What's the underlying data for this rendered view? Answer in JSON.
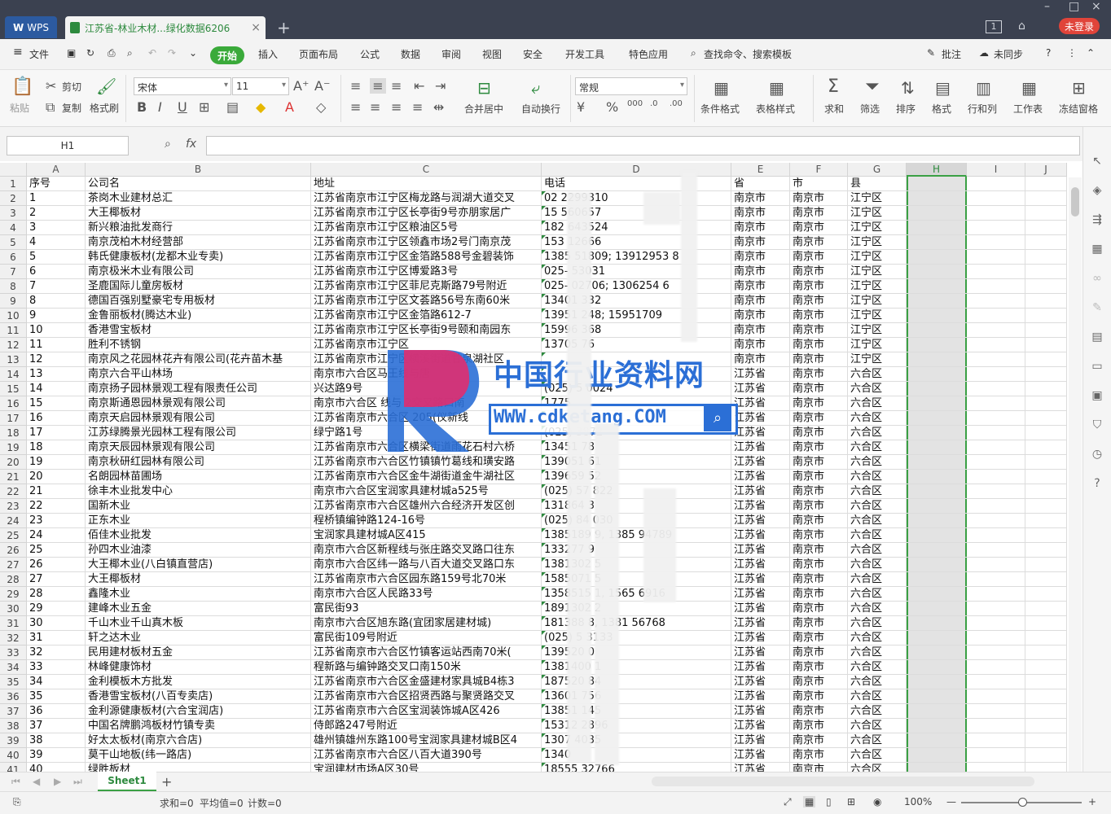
{
  "titlebar": {
    "app_tab": "WPS",
    "doc_tab": "江苏省-林业木材...绿化数据6206",
    "badge": "1",
    "login": "未登录"
  },
  "menubar": {
    "file": "文件",
    "items": [
      "开始",
      "插入",
      "页面布局",
      "公式",
      "数据",
      "审阅",
      "视图",
      "安全",
      "开发工具",
      "特色应用"
    ],
    "search": "查找命令、搜索模板",
    "comment": "批注",
    "sync": "未同步"
  },
  "ribbon": {
    "paste": "粘贴",
    "cut": "剪切",
    "copy": "复制",
    "format_painter": "格式刷",
    "font": "宋体",
    "size": "11",
    "merge": "合并居中",
    "wrap": "自动换行",
    "number_format": "常规",
    "cond_format": "条件格式",
    "table_style": "表格样式",
    "sum": "求和",
    "filter": "筛选",
    "sort": "排序",
    "format": "格式",
    "rowcol": "行和列",
    "sheet": "工作表",
    "freeze": "冻结窗格"
  },
  "formula_bar": {
    "name_box": "H1",
    "fx": "fx",
    "value": ""
  },
  "columns": [
    "A",
    "B",
    "C",
    "D",
    "E",
    "F",
    "G",
    "H",
    "I",
    "J"
  ],
  "header_row": [
    "序号",
    "公司名",
    "地址",
    "电话",
    "省",
    "市",
    "县"
  ],
  "rows": [
    [
      "1",
      "茶岗木业建材总汇",
      "江苏省南京市江宁区梅龙路与润湖大道交叉",
      "02    2299310",
      "南京市",
      "南京市",
      "江宁区"
    ],
    [
      "2",
      "大王椰板材",
      "江苏省南京市江宁区长亭街9号亦朋家居广",
      "15    560657",
      "南京市",
      "南京市",
      "江宁区"
    ],
    [
      "3",
      "新兴粮油批发商行",
      "江苏省南京市江宁区粮油区5号",
      "182   643524",
      "南京市",
      "南京市",
      "江宁区"
    ],
    [
      "4",
      "南京茂柏木材经营部",
      "江苏省南京市江宁区领鑫市场2号门南京茂",
      "153   12666",
      "南京市",
      "南京市",
      "江宁区"
    ],
    [
      "5",
      "韩氏健康板材(龙都木业专卖)",
      "江苏省南京市江宁区金箔路588号金碧装饰",
      "1385   51809; 13912953   8",
      "南京市",
      "南京市",
      "江宁区"
    ],
    [
      "6",
      "南京极米木业有限公司",
      "江苏省南京市江宁区博爱路3号",
      "025-  53031",
      "南京市",
      "南京市",
      "江宁区"
    ],
    [
      "7",
      "圣鹿国际儿童房板材",
      "江苏省南京市江宁区菲尼克斯路79号附近",
      "025-  02706; 1306254   6",
      "南京市",
      "南京市",
      "江宁区"
    ],
    [
      "8",
      "德国百强别墅豪宅专用板材",
      "江苏省南京市江宁区文荟路56号东南60米",
      "13401  332",
      "南京市",
      "南京市",
      "江宁区"
    ],
    [
      "9",
      "金鲁丽板材(腾达木业)",
      "江苏省南京市江宁区金箔路612-7",
      "13951  248; 15951709",
      "南京市",
      "南京市",
      "江宁区"
    ],
    [
      "10",
      "香港雪宝板材",
      "江苏省南京市江宁区长亭街9号颐和南园东",
      "15996  368",
      "南京市",
      "南京市",
      "江宁区"
    ],
    [
      "11",
      "胜利不锈钢",
      "江苏省南京市江宁区",
      "13705  76",
      "南京市",
      "南京市",
      "江宁区"
    ],
    [
      "12",
      "南京风之花园林花卉有限公司(花卉苗木基",
      "江苏省南京市江宁区横溪街道甘泉湖社区",
      "",
      "南京市",
      "南京市",
      "江宁区"
    ],
    [
      "13",
      "南京六合平山林场",
      "南京市六合区马王线与唐",
      "",
      "江苏省",
      "南京市",
      "六合区"
    ],
    [
      "14",
      "南京扬子园林景观工程有限责任公司",
      "兴达路9号",
      "(025) 5  0024",
      "江苏省",
      "南京市",
      "六合区"
    ],
    [
      "15",
      "南京斯通恩园林景观有限公司",
      "南京市六合区   线与   2交叉路口南",
      "1775",
      "江苏省",
      "南京市",
      "六合区"
    ],
    [
      "16",
      "南京天启园林景观有限公司",
      "江苏省南京市六合区   205(仪新线",
      "",
      "江苏省",
      "南京市",
      "六合区"
    ],
    [
      "17",
      "江苏绿腾景光园林工程有限公司",
      "绿宁路1号",
      "(025)  3872",
      "江苏省",
      "南京市",
      "六合区"
    ],
    [
      "18",
      "南京天辰园林景观有限公司",
      "江苏省南京市六合区横梁街道雨花石村六桥",
      "13451  78",
      "江苏省",
      "南京市",
      "六合区"
    ],
    [
      "19",
      "南京秋研红园林有限公司",
      "江苏省南京市六合区竹镇镇竹葛线和璜安路",
      "139051  61",
      "江苏省",
      "南京市",
      "六合区"
    ],
    [
      "20",
      "名朗园林苗圃场",
      "江苏省南京市六合区金牛湖街道金牛湖社区",
      "139659  52",
      "江苏省",
      "南京市",
      "六合区"
    ],
    [
      "21",
      "徐丰木业批发中心",
      "南京市六合区宝润家具建材城a525号",
      "(025) 57  822",
      "江苏省",
      "南京市",
      "六合区"
    ],
    [
      "22",
      "国新木业",
      "江苏省南京市六合区雄州六合经济开发区创",
      "131864  3",
      "江苏省",
      "南京市",
      "六合区"
    ],
    [
      "23",
      "正东木业",
      "程桥镇编钟路124-16号",
      "(025) 84  030",
      "江苏省",
      "南京市",
      "六合区"
    ],
    [
      "24",
      "佰佳木业批发",
      "宝润家具建材城A区415",
      "1385189  9, 1385  94789",
      "江苏省",
      "南京市",
      "六合区"
    ],
    [
      "25",
      "孙四木业油漆",
      "南京市六合区新程线与张庄路交叉路口往东",
      "133277  9",
      "江苏省",
      "南京市",
      "六合区"
    ],
    [
      "26",
      "大王椰木业(八白镇直营店)",
      "南京市六合区纬一路与八百大道交叉路口东",
      "1381302  5",
      "江苏省",
      "南京市",
      "六合区"
    ],
    [
      "27",
      "大王椰板材",
      "江苏省南京市六合区园东路159号北70米",
      "1585071  5",
      "江苏省",
      "南京市",
      "六合区"
    ],
    [
      "28",
      "鑫隆木业",
      "南京市六合区人民路33号",
      "1358515  1, 1565  6916",
      "江苏省",
      "南京市",
      "六合区"
    ],
    [
      "29",
      "建峰木业五金",
      "富民街93",
      "1891302  2",
      "江苏省",
      "南京市",
      "六合区"
    ],
    [
      "30",
      "千山木业千山真木板",
      "南京市六合区旭东路(宜团家居建材城)",
      "181388  8, 1381  56768",
      "江苏省",
      "南京市",
      "六合区"
    ],
    [
      "31",
      "轩之达木业",
      "富民街109号附近",
      "(025) 5  3133",
      "江苏省",
      "南京市",
      "六合区"
    ],
    [
      "32",
      "民用建材板材五金",
      "江苏省南京市六合区竹镇客运站西南70米(",
      "139520  0",
      "江苏省",
      "南京市",
      "六合区"
    ],
    [
      "33",
      "林峰健康饰材",
      "程新路与编钟路交叉口南150米",
      "1381400  1",
      "江苏省",
      "南京市",
      "六合区"
    ],
    [
      "34",
      "金利模板木方批发",
      "江苏省南京市六合区金盛建材家具城B4栋3",
      "187520  84",
      "江苏省",
      "南京市",
      "六合区"
    ],
    [
      "35",
      "香港雪宝板材(八百专卖店)",
      "江苏省南京市六合区招贤西路与聚贤路交叉",
      "13601  756",
      "江苏省",
      "南京市",
      "六合区"
    ],
    [
      "36",
      "金利源健康板材(六合宝润店)",
      "江苏省南京市六合区宝润装饰城A区426",
      "13851  145",
      "江苏省",
      "南京市",
      "六合区"
    ],
    [
      "37",
      "中国名牌鹏鸿板材竹镇专卖",
      "侍郎路247号附近",
      "15312  2896",
      "江苏省",
      "南京市",
      "六合区"
    ],
    [
      "38",
      "好太太板材(南京六合店)",
      "雄州镇雄州东路100号宝润家具建材城B区4",
      "1307  4035",
      "江苏省",
      "南京市",
      "六合区"
    ],
    [
      "39",
      "莫干山地板(纬一路店)",
      "江苏省南京市六合区八百大道390号",
      "1340  ",
      "江苏省",
      "南京市",
      "六合区"
    ],
    [
      "40",
      "绿胜板材",
      "宝润建材市场A区30号",
      "18555    32766",
      "江苏省",
      "南京市",
      "六合区"
    ]
  ],
  "watermark": {
    "title": "中国行业资料网",
    "url": "WWW.cdketang.COM"
  },
  "sheets": [
    "Sheet1"
  ],
  "status": {
    "sum": "求和=0",
    "avg": "平均值=0",
    "count": "计数=0",
    "zoom": "100%"
  }
}
